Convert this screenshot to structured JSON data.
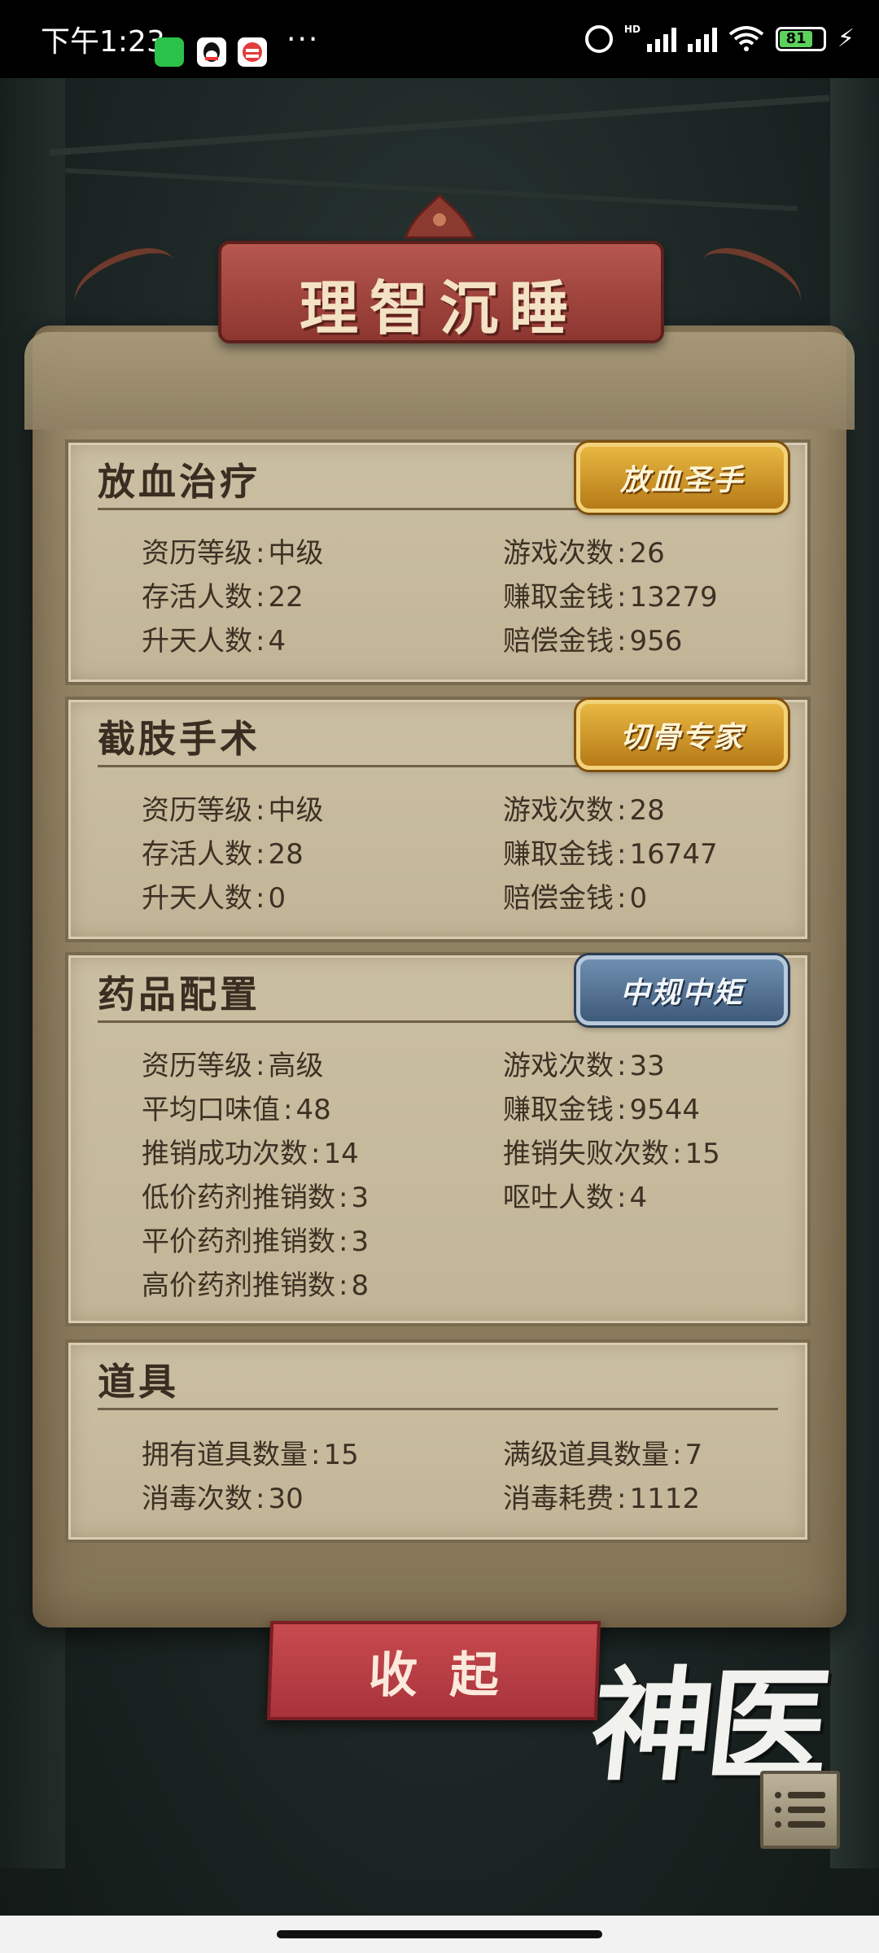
{
  "status_bar": {
    "time": "下午1:23",
    "battery": "81",
    "network": "HD"
  },
  "title": "理智沉睡",
  "cards": [
    {
      "title": "放血治疗",
      "badge": "放血圣手",
      "left": [
        {
          "label": "资历等级",
          "value": "中级"
        },
        {
          "label": "存活人数",
          "value": "22"
        },
        {
          "label": "升天人数",
          "value": "4"
        }
      ],
      "right": [
        {
          "label": "游戏次数",
          "value": "26"
        },
        {
          "label": "赚取金钱",
          "value": "13279"
        },
        {
          "label": "赔偿金钱",
          "value": "956"
        }
      ]
    },
    {
      "title": "截肢手术",
      "badge": "切骨专家",
      "left": [
        {
          "label": "资历等级",
          "value": "中级"
        },
        {
          "label": "存活人数",
          "value": "28"
        },
        {
          "label": "升天人数",
          "value": "0"
        }
      ],
      "right": [
        {
          "label": "游戏次数",
          "value": "28"
        },
        {
          "label": "赚取金钱",
          "value": "16747"
        },
        {
          "label": "赔偿金钱",
          "value": "0"
        }
      ]
    },
    {
      "title": "药品配置",
      "badge": "中规中矩",
      "left": [
        {
          "label": "资历等级",
          "value": "高级"
        },
        {
          "label": "平均口味值",
          "value": "48"
        },
        {
          "label": "推销成功次数",
          "value": "14"
        },
        {
          "label": "低价药剂推销数",
          "value": "3"
        },
        {
          "label": "平价药剂推销数",
          "value": "3"
        },
        {
          "label": "高价药剂推销数",
          "value": "8"
        }
      ],
      "right": [
        {
          "label": "游戏次数",
          "value": "33"
        },
        {
          "label": "赚取金钱",
          "value": "9544"
        },
        {
          "label": "推销失败次数",
          "value": "15"
        },
        {
          "label": "呕吐人数",
          "value": "4"
        }
      ]
    },
    {
      "title": "道具",
      "left": [
        {
          "label": "拥有道具数量",
          "value": "15"
        },
        {
          "label": "消毒次数",
          "value": "30"
        }
      ],
      "right": [
        {
          "label": "满级道具数量",
          "value": "7"
        },
        {
          "label": "消毒耗费",
          "value": "1112"
        }
      ]
    }
  ],
  "collapse_button": "收起",
  "brand": "神医",
  "colors": {
    "banner": "#a8473f",
    "parchment": "#c6b99c",
    "gold_badge": "#d39a2c",
    "blue_badge": "#56728f",
    "button_red": "#b83e44"
  }
}
